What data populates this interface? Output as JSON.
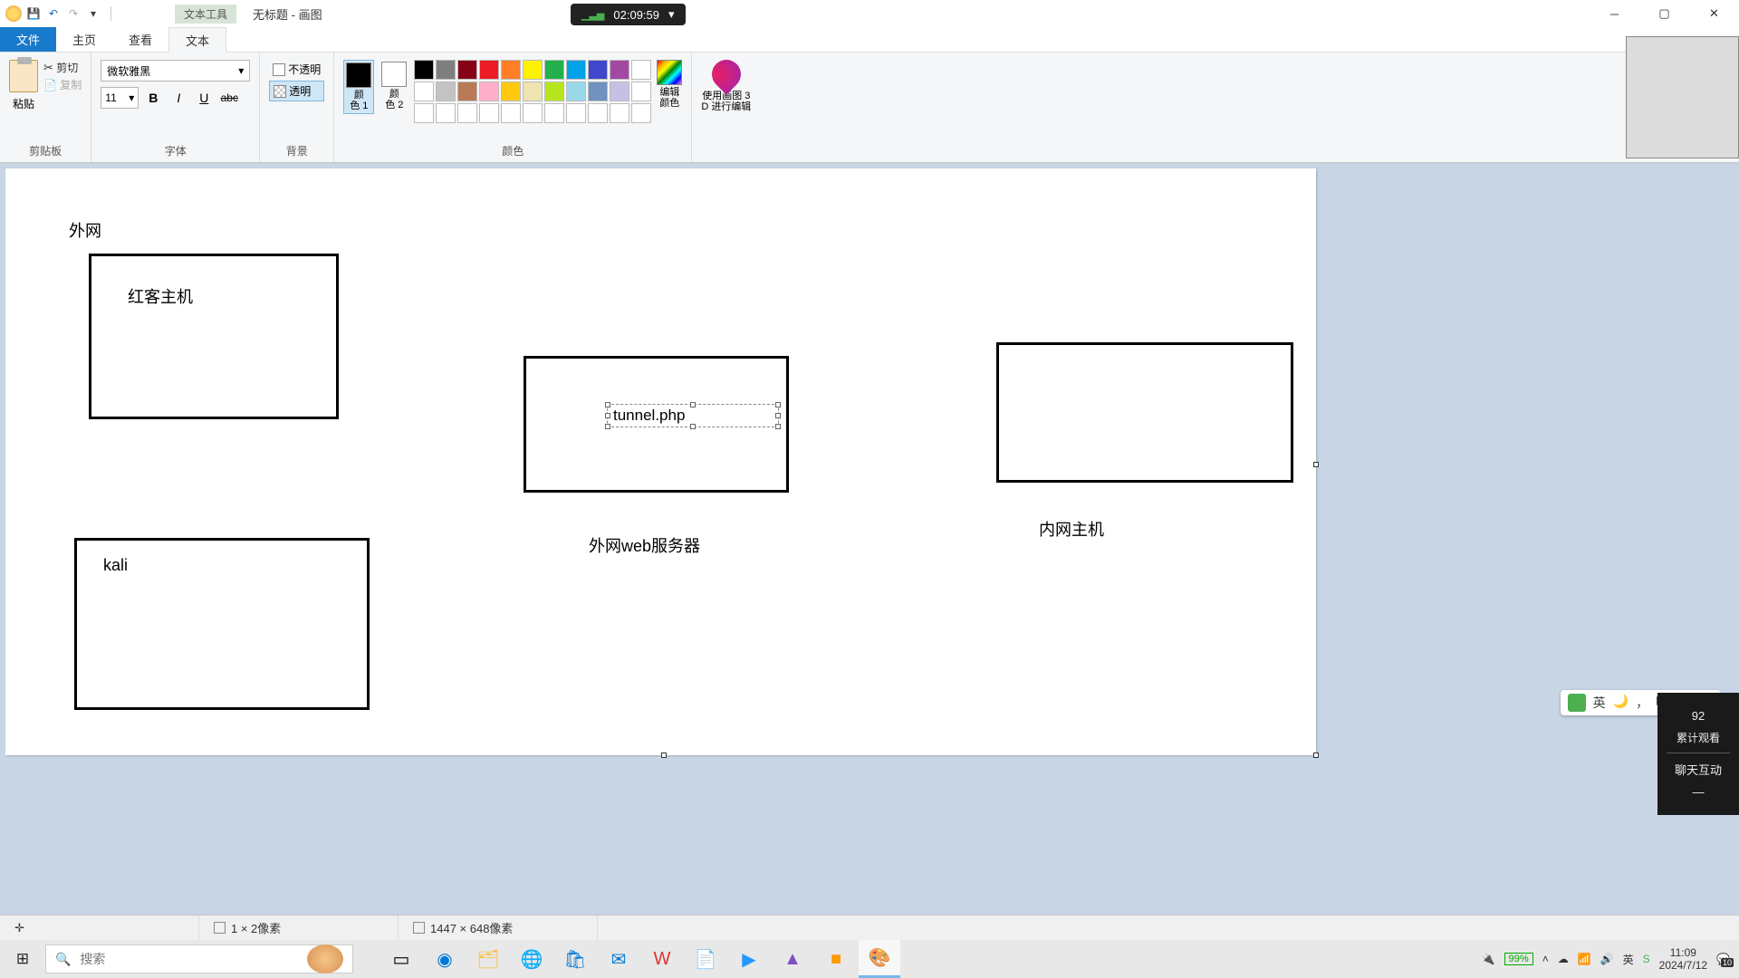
{
  "titlebar": {
    "context_tool": "文本工具",
    "title": "无标题 - 画图"
  },
  "timer": {
    "time": "02:09:59"
  },
  "tabs": {
    "file": "文件",
    "home": "主页",
    "view": "查看",
    "text": "文本"
  },
  "ribbon": {
    "clipboard": {
      "paste": "粘贴",
      "cut": "剪切",
      "copy": "复制",
      "label": "剪贴板"
    },
    "font": {
      "family": "微软雅黑",
      "size": "11",
      "label": "字体"
    },
    "background": {
      "opaque": "不透明",
      "transparent": "透明",
      "label": "背景"
    },
    "colors": {
      "c1": "颜\n色 1",
      "c2": "颜\n色 2",
      "edit": "编辑\n颜色",
      "label": "颜色"
    },
    "p3d": "使用画图 3\nD 进行编辑"
  },
  "palette_colors": [
    [
      "#000000",
      "#7f7f7f",
      "#880015",
      "#ed1c24",
      "#ff7f27",
      "#fff200",
      "#22b14c",
      "#00a2e8",
      "#3f48cc",
      "#a349a4",
      "#ffffff"
    ],
    [
      "#ffffff",
      "#c3c3c3",
      "#b97a57",
      "#ffaec9",
      "#ffc90e",
      "#efe4b0",
      "#b5e61d",
      "#99d9ea",
      "#7092be",
      "#c8bfe7",
      "#ffffff"
    ],
    [
      "#ffffff",
      "#ffffff",
      "#ffffff",
      "#ffffff",
      "#ffffff",
      "#ffffff",
      "#ffffff",
      "#ffffff",
      "#ffffff",
      "#ffffff",
      "#ffffff"
    ]
  ],
  "canvas": {
    "texts": {
      "outer_net": "外网",
      "red_host": "红客主机",
      "kali": "kali",
      "tunnel": "tunnel.php",
      "web_server": "外网web服务器",
      "inner_host": "内网主机"
    }
  },
  "status": {
    "selection": "1 × 2像素",
    "canvas_size": "1447 × 648像素"
  },
  "taskbar": {
    "search_placeholder": "搜索"
  },
  "tray": {
    "battery": "99%",
    "lang": "英",
    "time": "11:09",
    "date": "2024/7/12",
    "notif": "10"
  },
  "ime": {
    "lang": "英"
  },
  "live": {
    "count": "92",
    "count_label": "累计观看",
    "chat": "聊天互动"
  }
}
